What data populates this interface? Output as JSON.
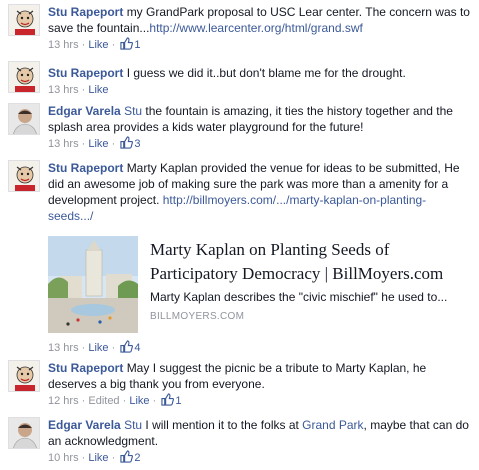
{
  "comments": [
    {
      "author": "Stu Rapeport",
      "avatar_icon": "stu-avatar-icon",
      "text": "my GrandPark proposal to USC Lear center. The concern was to save the fountain...",
      "link": "http://www.learcenter.org/html/grand.swf",
      "time": "13 hrs",
      "like": "Like",
      "likes": "1"
    },
    {
      "author": "Stu Rapeport",
      "avatar_icon": "stu-avatar-icon",
      "text": "I guess we did it..but don't blame me for the drought.",
      "time": "13 hrs",
      "like": "Like"
    },
    {
      "author": "Edgar Varela",
      "avatar_icon": "edgar-avatar-icon",
      "mention": "Stu",
      "text": "the fountain is amazing, it ties the history together and the splash area provides a kids water playground for the future!",
      "time": "13 hrs",
      "like": "Like",
      "likes": "3"
    },
    {
      "author": "Stu Rapeport",
      "avatar_icon": "stu-avatar-icon",
      "text": "Marty Kaplan provided the venue for ideas to be submitted, He did an awesome job of making sure the park was more than a amenity for a development project.",
      "link": "http://billmoyers.com/.../marty-kaplan-on-planting-seeds.../",
      "preview": {
        "title": "Marty Kaplan on Planting Seeds of Participatory Democracy | BillMoyers.com",
        "description": "Marty Kaplan describes the \"civic mischief\" he used to...",
        "source": "BILLMOYERS.COM"
      },
      "time": "13 hrs",
      "like": "Like",
      "likes": "4"
    },
    {
      "author": "Stu Rapeport",
      "avatar_icon": "stu-avatar-icon",
      "text": "May I suggest the picnic be a tribute to Marty Kaplan, he deserves a big thank you from everyone.",
      "time": "12 hrs",
      "edited": "Edited",
      "like": "Like",
      "likes": "1"
    },
    {
      "author": "Edgar Varela",
      "avatar_icon": "edgar-avatar-icon",
      "mention": "Stu",
      "text_before": "I will mention it to the folks at",
      "place": "Grand Park",
      "text_after": ", maybe that can do an acknowledgment.",
      "time": "10 hrs",
      "like": "Like",
      "likes": "2"
    }
  ],
  "colors": {
    "link": "#3b5998",
    "meta": "#90949c",
    "text": "#141823"
  }
}
